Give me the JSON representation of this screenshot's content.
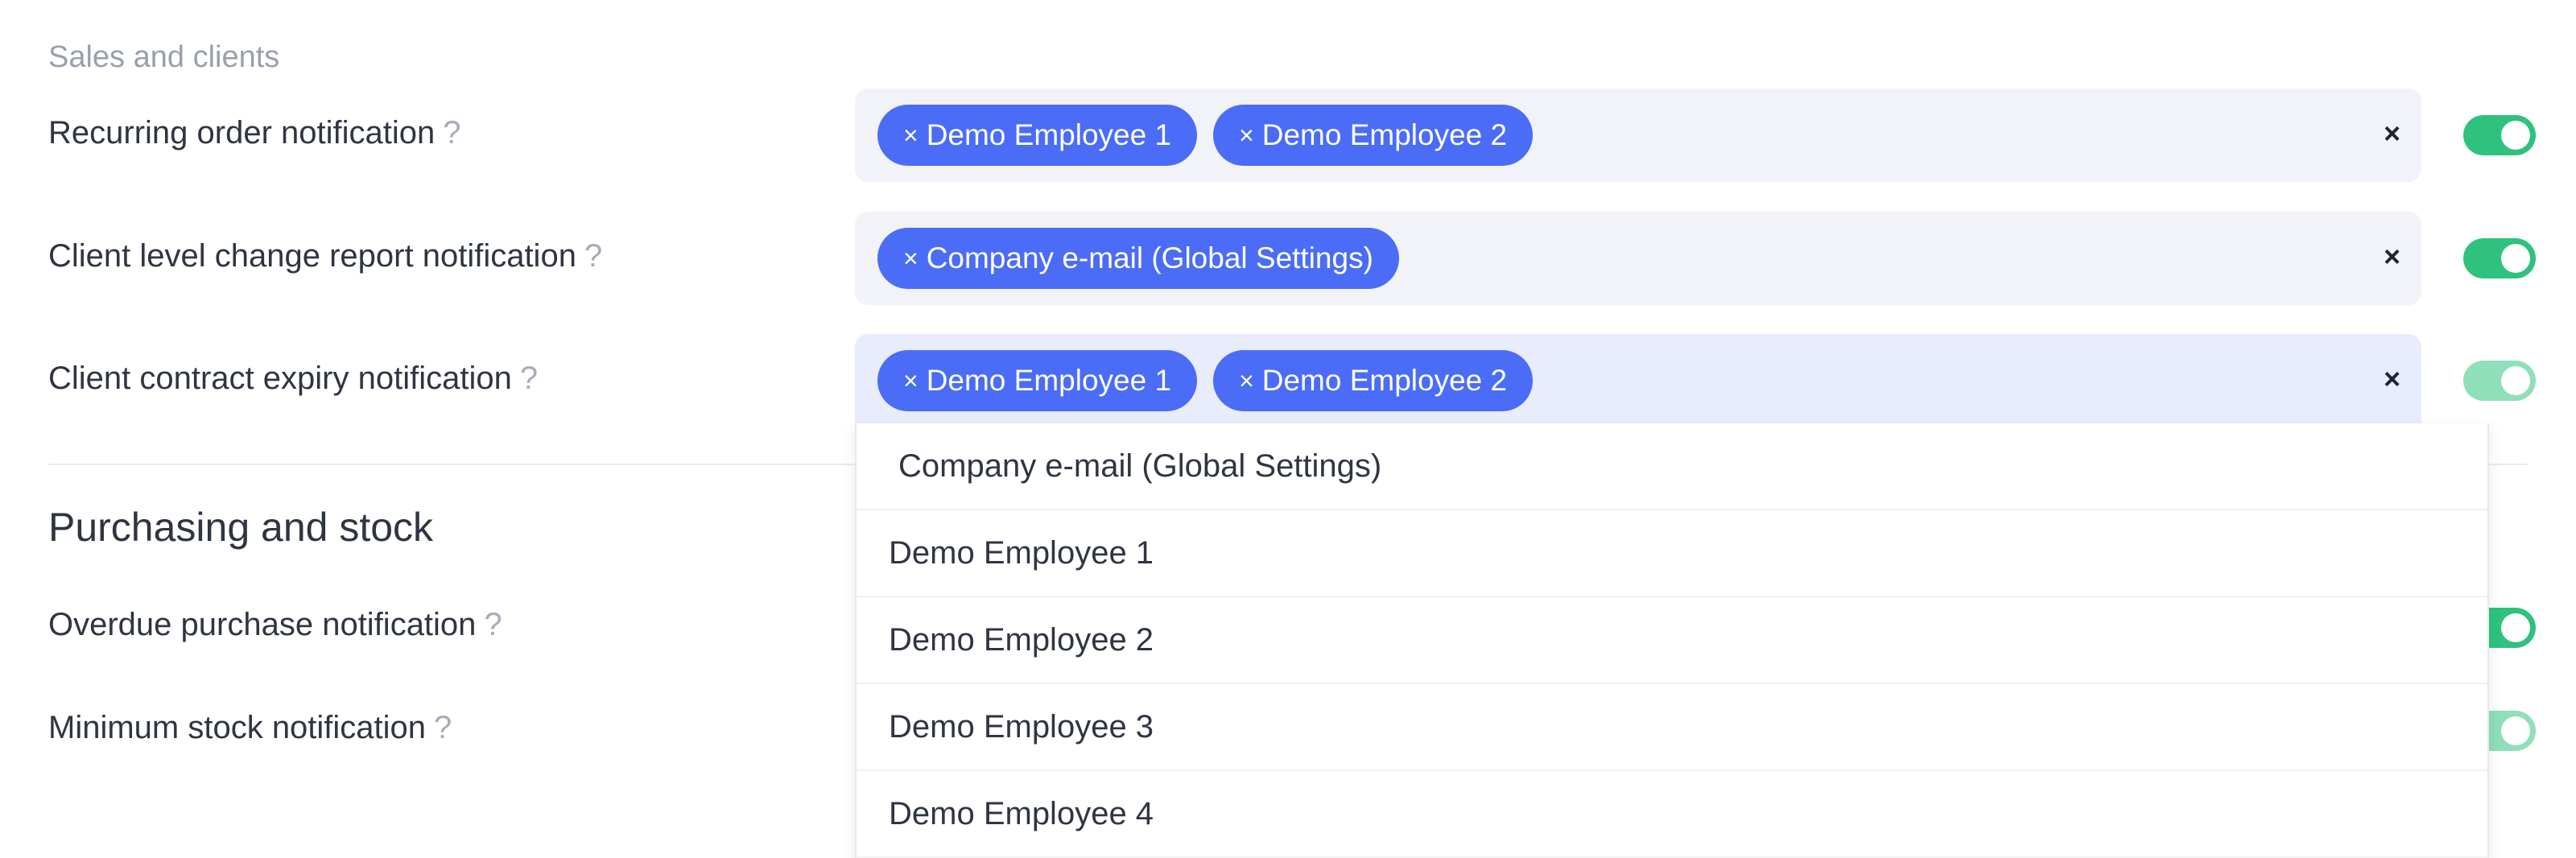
{
  "sales": {
    "caption": "Sales and clients",
    "rows": [
      {
        "label": "Recurring order notification",
        "help": "?",
        "chips": [
          "Demo Employee 1",
          "Demo Employee 2"
        ],
        "enabled": true
      },
      {
        "label": "Client level change report notification",
        "help": "?",
        "chips": [
          "Company e-mail (Global Settings)"
        ],
        "enabled": true
      },
      {
        "label": "Client contract expiry notification",
        "help": "?",
        "chips": [
          "Demo Employee 1",
          "Demo Employee 2"
        ],
        "enabled": true
      }
    ]
  },
  "purchasing": {
    "heading": "Purchasing and stock",
    "rows": [
      {
        "label": "Overdue purchase notification",
        "help": "?",
        "enabled": true
      },
      {
        "label": "Minimum stock notification",
        "help": "?",
        "enabled": true
      }
    ]
  },
  "icons": {
    "remove_chip": "×",
    "clear_selection": "×"
  },
  "dropdown": {
    "options": [
      "Company e-mail (Global Settings)",
      "Demo Employee 1",
      "Demo Employee 2",
      "Demo Employee 3",
      "Demo Employee 4"
    ]
  },
  "colors": {
    "chip": "#4a6cf7",
    "toggle_on": "#2ec27e",
    "toggle_on_dim": "#8fdfb8",
    "input_bg": "#f2f3f8",
    "input_focus_bg": "#e8ecfd"
  }
}
